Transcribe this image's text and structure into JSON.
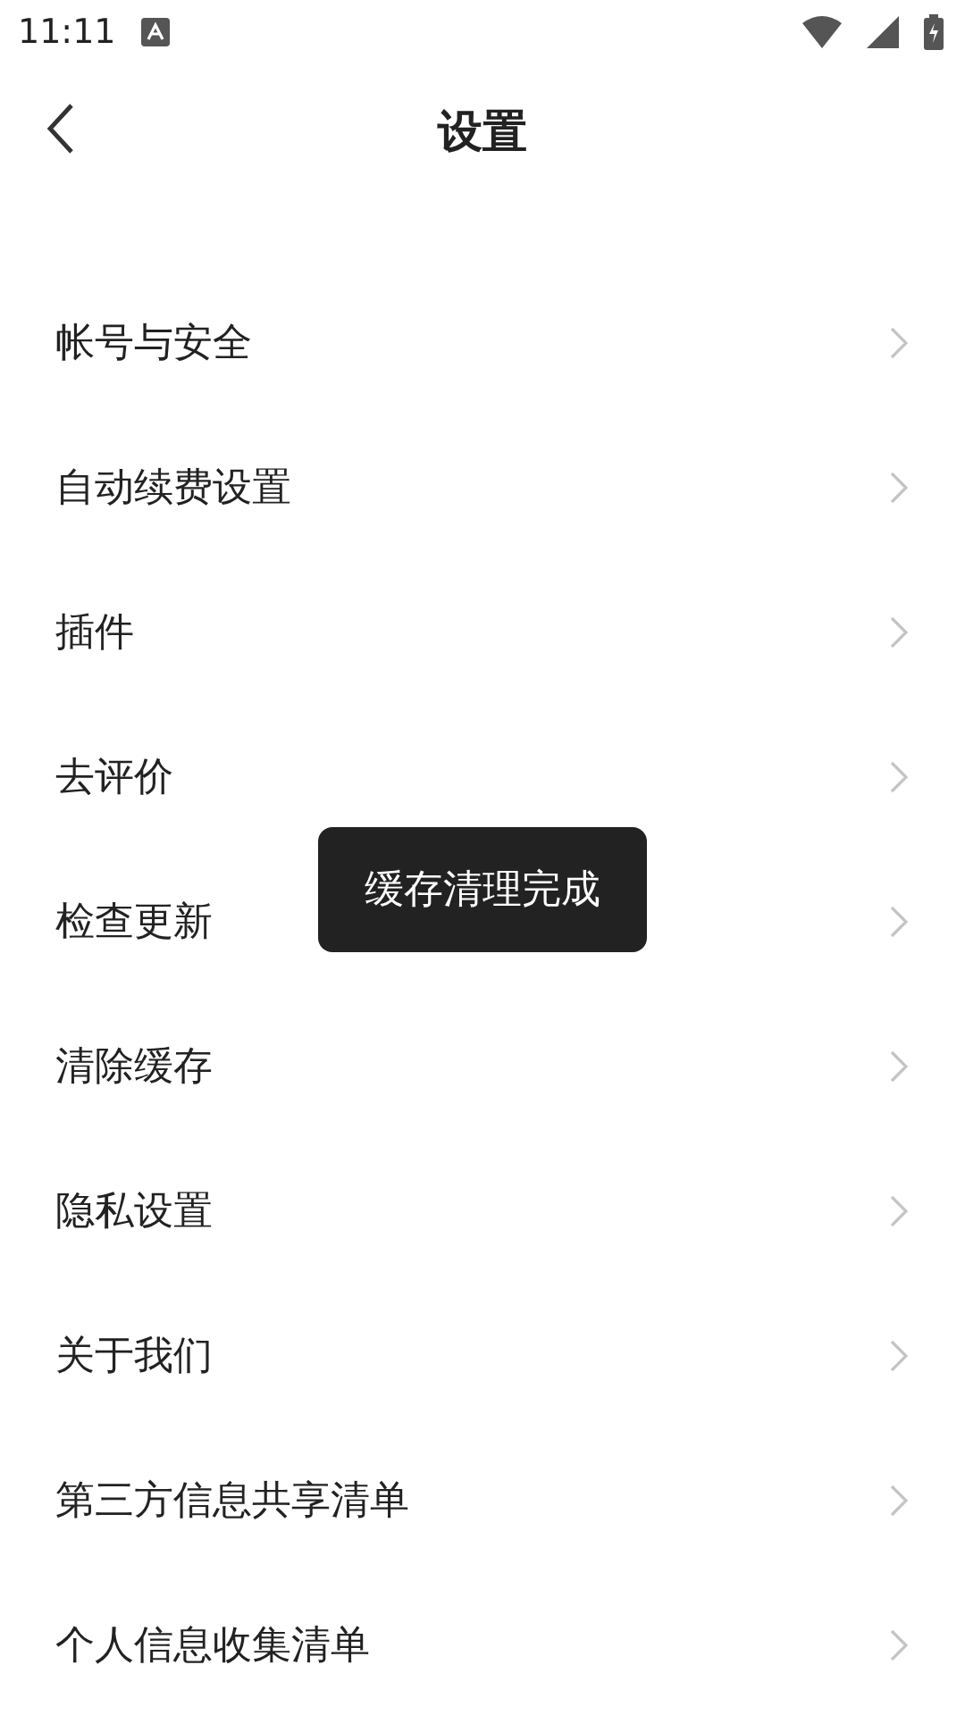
{
  "status_bar": {
    "time": "11:11"
  },
  "header": {
    "title": "设置"
  },
  "items": [
    {
      "label": "帐号与安全"
    },
    {
      "label": "自动续费设置"
    },
    {
      "label": "插件"
    },
    {
      "label": "去评价"
    },
    {
      "label": "检查更新"
    },
    {
      "label": "清除缓存"
    },
    {
      "label": "隐私设置"
    },
    {
      "label": "关于我们"
    },
    {
      "label": "第三方信息共享清单"
    },
    {
      "label": "个人信息收集清单"
    }
  ],
  "toast": {
    "text": "缓存清理完成"
  }
}
